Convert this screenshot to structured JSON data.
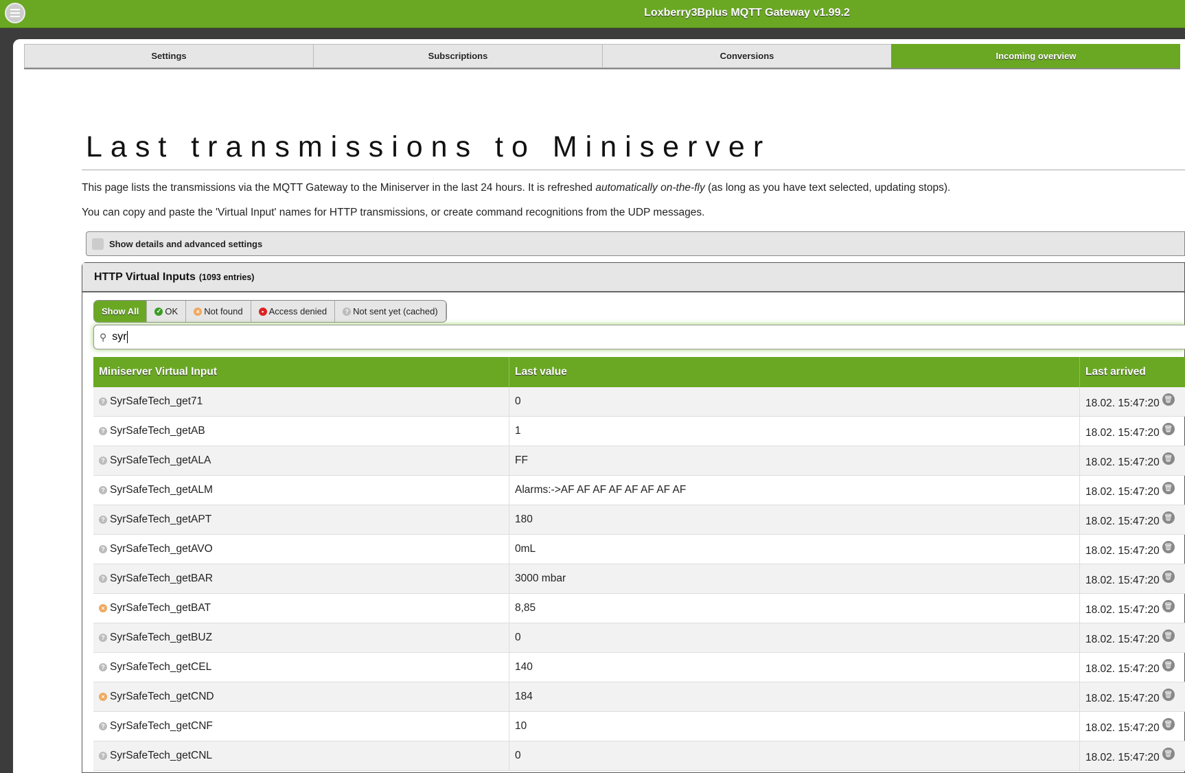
{
  "app_title": "Loxberry3Bplus MQTT Gateway v1.99.2",
  "tabs": [
    {
      "label": "Settings"
    },
    {
      "label": "Subscriptions"
    },
    {
      "label": "Conversions"
    },
    {
      "label": "Incoming overview"
    }
  ],
  "heading": "Last transmissions to Miniserver",
  "intro1_a": "This page lists the transmissions via the MQTT Gateway to the Miniserver in the last 24 hours. It is refreshed ",
  "intro1_em": "automatically on-the-fly",
  "intro1_b": " (as long as you have text selected, updating stops).",
  "intro2": "You can copy and paste the 'Virtual Input' names for HTTP transmissions, or create command recognitions from the UDP messages.",
  "advanced_label": "Show details and advanced settings",
  "section": {
    "title": "HTTP Virtual Inputs",
    "count": "(1093 entries)"
  },
  "filters": [
    {
      "label": "Show All"
    },
    {
      "label": "OK"
    },
    {
      "label": "Not found"
    },
    {
      "label": "Access denied"
    },
    {
      "label": "Not sent yet (cached)"
    }
  ],
  "search": {
    "value": "syr"
  },
  "columns": [
    "Miniserver Virtual Input",
    "Last value",
    "Last arrived"
  ],
  "status_colors": {
    "cached": "#bbbbbb",
    "notfound": "#f0a860",
    "ok": "#3a9d23",
    "denied": "#d22"
  },
  "rows": [
    {
      "name": "SyrSafeTech_get71",
      "value": "0",
      "time": "18.02. 15:47:20",
      "status": "cached"
    },
    {
      "name": "SyrSafeTech_getAB",
      "value": "1",
      "time": "18.02. 15:47:20",
      "status": "cached"
    },
    {
      "name": "SyrSafeTech_getALA",
      "value": "FF",
      "time": "18.02. 15:47:20",
      "status": "cached"
    },
    {
      "name": "SyrSafeTech_getALM",
      "value": "Alarms:->AF AF AF AF AF AF AF AF",
      "time": "18.02. 15:47:20",
      "status": "cached"
    },
    {
      "name": "SyrSafeTech_getAPT",
      "value": "180",
      "time": "18.02. 15:47:20",
      "status": "cached"
    },
    {
      "name": "SyrSafeTech_getAVO",
      "value": "0mL",
      "time": "18.02. 15:47:20",
      "status": "cached"
    },
    {
      "name": "SyrSafeTech_getBAR",
      "value": "3000 mbar",
      "time": "18.02. 15:47:20",
      "status": "cached"
    },
    {
      "name": "SyrSafeTech_getBAT",
      "value": "8,85",
      "time": "18.02. 15:47:20",
      "status": "notfound"
    },
    {
      "name": "SyrSafeTech_getBUZ",
      "value": "0",
      "time": "18.02. 15:47:20",
      "status": "cached"
    },
    {
      "name": "SyrSafeTech_getCEL",
      "value": "140",
      "time": "18.02. 15:47:20",
      "status": "cached"
    },
    {
      "name": "SyrSafeTech_getCND",
      "value": "184",
      "time": "18.02. 15:47:20",
      "status": "notfound"
    },
    {
      "name": "SyrSafeTech_getCNF",
      "value": "10",
      "time": "18.02. 15:47:20",
      "status": "cached"
    },
    {
      "name": "SyrSafeTech_getCNL",
      "value": "0",
      "time": "18.02. 15:47:20",
      "status": "cached"
    }
  ]
}
